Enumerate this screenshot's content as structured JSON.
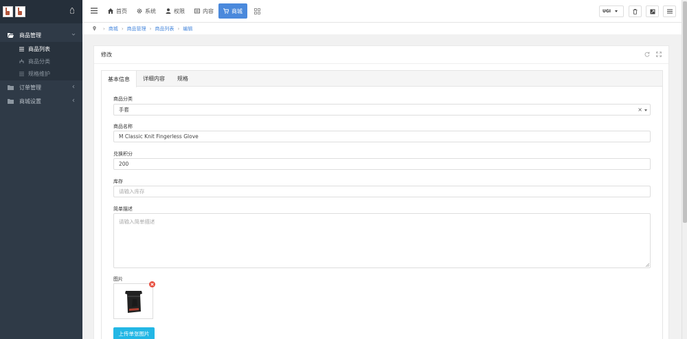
{
  "sidebar": {
    "menu": [
      {
        "label": "商品管理",
        "expanded": true,
        "active": true,
        "children": [
          {
            "label": "商品列表",
            "active": true
          },
          {
            "label": "商品分类",
            "active": false
          },
          {
            "label": "规格维护",
            "active": false
          }
        ]
      },
      {
        "label": "订单管理",
        "expanded": false
      },
      {
        "label": "商城设置",
        "expanded": false
      }
    ]
  },
  "topbar": {
    "nav": [
      {
        "label": "首页",
        "icon": "home-icon"
      },
      {
        "label": "系统",
        "icon": "gear-icon"
      },
      {
        "label": "权限",
        "icon": "user-icon"
      },
      {
        "label": "内容",
        "icon": "newspaper-icon"
      },
      {
        "label": "商城",
        "icon": "cart-icon",
        "active": true
      }
    ],
    "lang_label": "UGI"
  },
  "breadcrumb": [
    "商城",
    "商品管理",
    "商品列表",
    "编辑"
  ],
  "panel": {
    "title": "修改",
    "tabs": [
      "基本信息",
      "详细内容",
      "规格"
    ],
    "form": {
      "category": {
        "label": "商品分类",
        "value": "手套"
      },
      "name": {
        "label": "商品名称",
        "value": "M Classic Knit Fingerless Glove"
      },
      "points": {
        "label": "兑换积分",
        "value": "200"
      },
      "stock": {
        "label": "库存",
        "placeholder": "请输入库存"
      },
      "description": {
        "label": "简单描述",
        "placeholder": "请输入简单描述"
      },
      "image": {
        "label": "图片"
      },
      "upload_label": "上传单张图片"
    }
  },
  "colors": {
    "sidebar_bg": "#2f3a47",
    "accent": "#4a89dc",
    "upload": "#23b7e5",
    "remove": "#e74c3c"
  }
}
